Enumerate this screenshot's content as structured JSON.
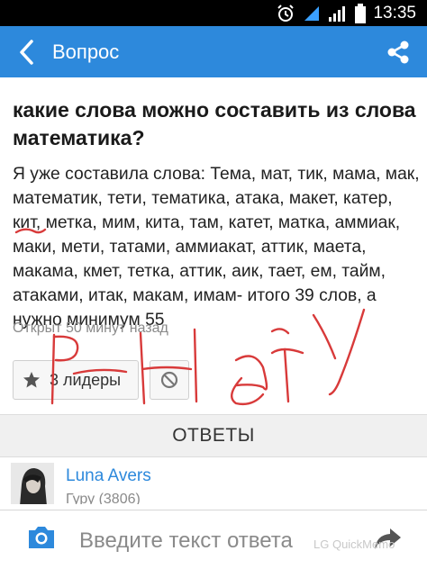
{
  "status_bar": {
    "time": "13:35",
    "icons": [
      "alarm-icon",
      "wifi-icon",
      "signal-icon",
      "battery-icon"
    ]
  },
  "app_bar": {
    "title": "Вопрос",
    "icons": [
      "back-arrow-icon",
      "share-icon"
    ],
    "color": "#2d89dc"
  },
  "question": {
    "title": "какие слова можно составить из слова математика?",
    "body": "Я уже составила слова: Тема, мат, тик, мама, мак, математик, тети, тематика, атака, макет, катер, кит, метка, мим, кита, там, катет, матка, аммиак, маки, мети, татами, аммиакат, аттик, маета, макама, кмет, тетка, аттик, аик, тает, ем, тайм, атаками, итак, макам, имам- итого 39 слов, а нужно минимум 55",
    "meta": "Открыт 50 минут назад"
  },
  "actions": {
    "leaders_label": "3 лидеры",
    "leaders_icon": "star-icon",
    "report_icon": "block-icon"
  },
  "answers": {
    "header": "ОТВЕТЫ",
    "items": [
      {
        "author": "Luna Avers",
        "rank": "Гуру (3806)"
      }
    ]
  },
  "compose": {
    "placeholder": "Введите текст ответа",
    "camera_icon": "camera-icon",
    "send_icon": "send-arrow-icon"
  },
  "overlay": {
    "handwriting": "Р-НЕТ",
    "ink_color": "#d83a3a",
    "watermark": "LG QuickMemo"
  }
}
